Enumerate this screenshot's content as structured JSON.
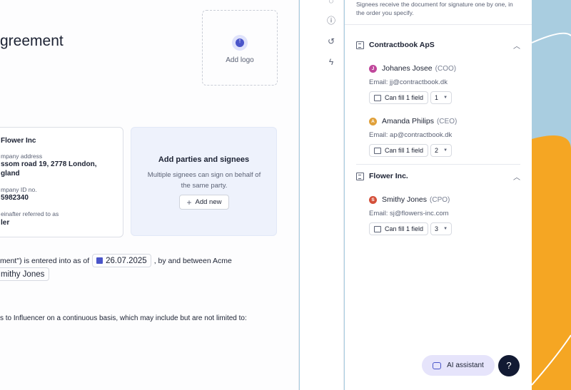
{
  "document": {
    "title_fragment": "greement",
    "add_logo_label": "Add logo",
    "upload_icon": "arrow-up-icon",
    "party_card": {
      "name": "Flower Inc",
      "address_label": "mpany address",
      "address_line1": "ssom road 19, 2778 London,",
      "address_line2": "gland",
      "id_label": "mpany ID no.",
      "id_value": "5982340",
      "referred_label": "einafter referred to as",
      "referred_value": "ler"
    },
    "add_parties": {
      "title": "Add parties and signees",
      "description": "Multiple signees can sign on behalf of the same party.",
      "button_label": "Add new"
    },
    "agreement_text_pre": "ment\") is entered into as of",
    "date_value": "26.07.2025",
    "agreement_text_post": ", by and between Acme",
    "name_chip": "mithy Jones",
    "services_text": "s to Influencer on a continuous basis, which may include but are not limited to:"
  },
  "panel": {
    "intro": "Signees receive the document for signature one by one, in the order you specify.",
    "fill_label": "Can fill 1 field",
    "organizations": [
      {
        "name": "Contractbook ApS",
        "signees": [
          {
            "initial": "J",
            "name": "Johanes Josee",
            "role": "(COO)",
            "email": "Email: jj@contractbook.dk",
            "order": "1",
            "color": "#c0479b"
          },
          {
            "initial": "A",
            "name": "Amanda Philips",
            "role": "(CEO)",
            "email": "Email: ap@contractbook.dk",
            "order": "2",
            "color": "#e0a03a"
          }
        ]
      },
      {
        "name": "Flower Inc.",
        "signees": [
          {
            "initial": "S",
            "name": "Smithy Jones",
            "role": "(CPO)",
            "email": "Email: sj@flowers-inc.com",
            "order": "3",
            "color": "#d4503a"
          }
        ]
      }
    ]
  },
  "assistant": {
    "ai_label": "AI assistant",
    "help_label": "?"
  },
  "colors": {
    "accent": "#4a55c9",
    "background_blue": "#a9cde0",
    "background_orange": "#f5a623",
    "help_button": "#121a33"
  }
}
